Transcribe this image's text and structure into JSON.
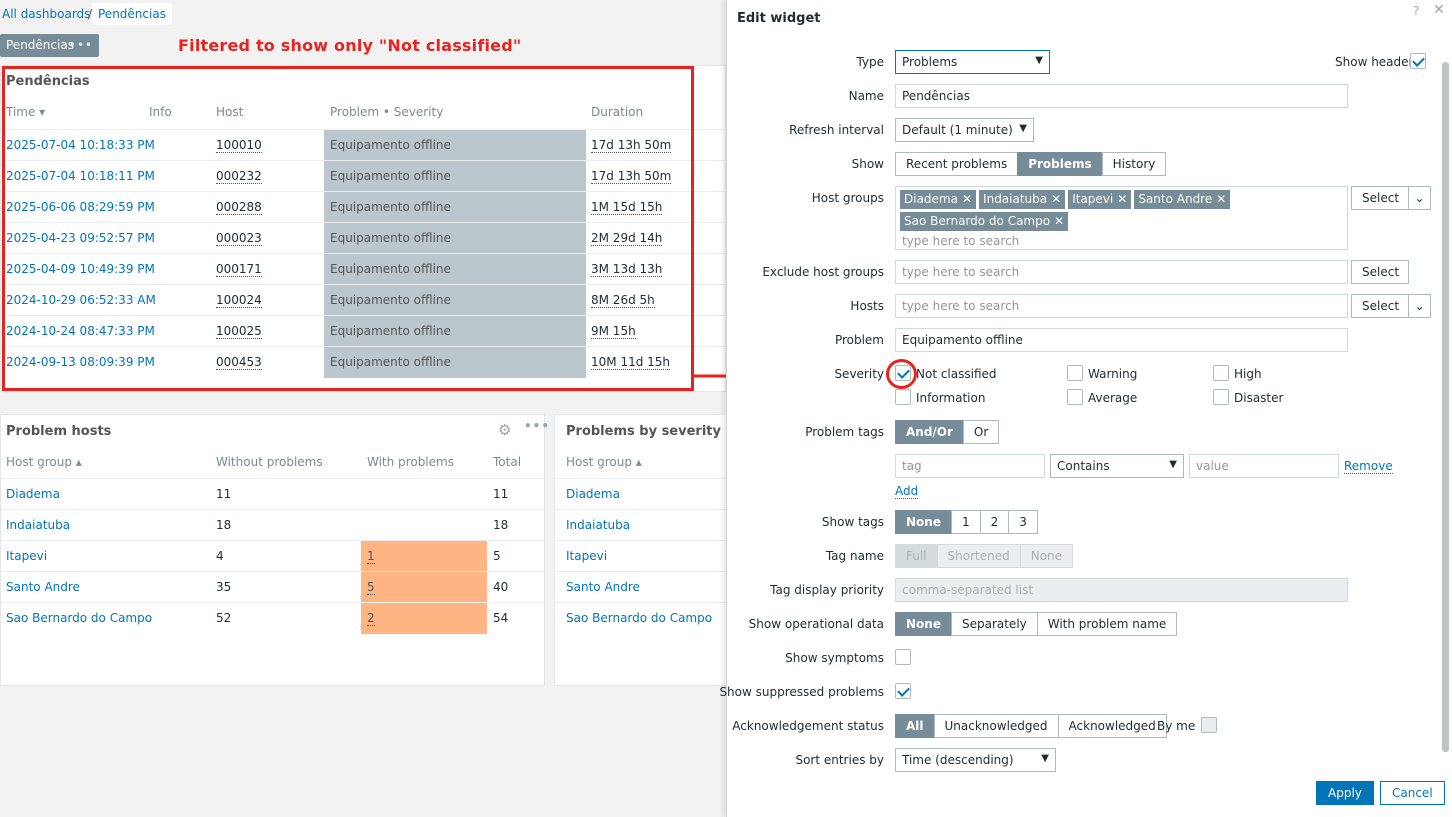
{
  "breadcrumb": {
    "root": "All dashboards",
    "sep": "/",
    "current": "Pendências"
  },
  "page_tab": {
    "label": "Pendências",
    "menu": "•••"
  },
  "annotation": {
    "text": "Filtered to show only \"Not classified\""
  },
  "problems_widget": {
    "title": "Pendências",
    "columns": {
      "time": "Time ▾",
      "info": "Info",
      "host": "Host",
      "problem": "Problem • Severity",
      "duration": "Duration"
    },
    "rows": [
      {
        "time": "2025-07-04 10:18:33 PM",
        "host": "100010",
        "problem": "Equipamento offline",
        "duration": "17d 13h 50m"
      },
      {
        "time": "2025-07-04 10:18:11 PM",
        "host": "000232",
        "problem": "Equipamento offline",
        "duration": "17d 13h 50m"
      },
      {
        "time": "2025-06-06 08:29:59 PM",
        "host": "000288",
        "problem": "Equipamento offline",
        "duration": "1M 15d 15h"
      },
      {
        "time": "2025-04-23 09:52:57 PM",
        "host": "000023",
        "problem": "Equipamento offline",
        "duration": "2M 29d 14h"
      },
      {
        "time": "2025-04-09 10:49:39 PM",
        "host": "000171",
        "problem": "Equipamento offline",
        "duration": "3M 13d 13h"
      },
      {
        "time": "2024-10-29 06:52:33 AM",
        "host": "100024",
        "problem": "Equipamento offline",
        "duration": "8M 26d 5h"
      },
      {
        "time": "2024-10-24 08:47:33 PM",
        "host": "100025",
        "problem": "Equipamento offline",
        "duration": "9M 15h"
      },
      {
        "time": "2024-09-13 08:09:39 PM",
        "host": "000453",
        "problem": "Equipamento offline",
        "duration": "10M 11d 15h"
      }
    ]
  },
  "problem_hosts": {
    "title": "Problem hosts",
    "columns": {
      "group": "Host group ▴",
      "without": "Without problems",
      "with": "With problems",
      "total": "Total"
    },
    "rows": [
      {
        "group": "Diadema",
        "without": "11",
        "with": "",
        "total": "11"
      },
      {
        "group": "Indaiatuba",
        "without": "18",
        "with": "",
        "total": "18"
      },
      {
        "group": "Itapevi",
        "without": "4",
        "with": "1",
        "total": "5"
      },
      {
        "group": "Santo Andre",
        "without": "35",
        "with": "5",
        "total": "40"
      },
      {
        "group": "Sao Bernardo do Campo",
        "without": "52",
        "with": "2",
        "total": "54"
      }
    ],
    "widget_menu": "•••"
  },
  "problems_by_severity": {
    "title": "Problems by severity",
    "columns": {
      "group": "Host group ▴"
    },
    "rows": [
      "Diadema",
      "Indaiatuba",
      "Itapevi",
      "Santo Andre",
      "Sao Bernardo do Campo"
    ]
  },
  "dialog": {
    "title": "Edit widget",
    "help": "?",
    "close": "✕",
    "type": {
      "label": "Type",
      "value": "Problems"
    },
    "show_header": {
      "label": "Show header",
      "checked": true
    },
    "name": {
      "label": "Name",
      "value": "Pendências"
    },
    "refresh": {
      "label": "Refresh interval",
      "value": "Default (1 minute)"
    },
    "show": {
      "label": "Show",
      "options": [
        "Recent problems",
        "Problems",
        "History"
      ],
      "selected": "Problems"
    },
    "host_groups": {
      "label": "Host groups",
      "tags": [
        "Diadema",
        "Indaiatuba",
        "Itapevi",
        "Santo Andre",
        "Sao Bernardo do Campo"
      ],
      "placeholder": "type here to search",
      "select": "Select"
    },
    "exclude_host_groups": {
      "label": "Exclude host groups",
      "placeholder": "type here to search",
      "select": "Select"
    },
    "hosts": {
      "label": "Hosts",
      "placeholder": "type here to search",
      "select": "Select"
    },
    "problem": {
      "label": "Problem",
      "value": "Equipamento offline"
    },
    "severity": {
      "label": "Severity",
      "options": [
        {
          "name": "Not classified",
          "checked": true
        },
        {
          "name": "Information",
          "checked": false
        },
        {
          "name": "Warning",
          "checked": false
        },
        {
          "name": "Average",
          "checked": false
        },
        {
          "name": "High",
          "checked": false
        },
        {
          "name": "Disaster",
          "checked": false
        }
      ]
    },
    "problem_tags": {
      "label": "Problem tags",
      "options": [
        "And/Or",
        "Or"
      ],
      "selected": "And/Or",
      "tag_placeholder": "tag",
      "operator": "Contains",
      "value_placeholder": "value",
      "remove": "Remove",
      "add": "Add"
    },
    "show_tags": {
      "label": "Show tags",
      "options": [
        "None",
        "1",
        "2",
        "3"
      ],
      "selected": "None"
    },
    "tag_name": {
      "label": "Tag name",
      "options": [
        "Full",
        "Shortened",
        "None"
      ],
      "selected": "Full"
    },
    "tag_priority": {
      "label": "Tag display priority",
      "placeholder": "comma-separated list"
    },
    "operational_data": {
      "label": "Show operational data",
      "options": [
        "None",
        "Separately",
        "With problem name"
      ],
      "selected": "None"
    },
    "show_symptoms": {
      "label": "Show symptoms",
      "checked": false
    },
    "show_suppressed": {
      "label": "Show suppressed problems",
      "checked": true
    },
    "ack_status": {
      "label": "Acknowledgement status",
      "options": [
        "All",
        "Unacknowledged",
        "Acknowledged"
      ],
      "selected": "All",
      "by_me": "By me"
    },
    "sort": {
      "label": "Sort entries by",
      "value": "Time (descending)"
    },
    "apply": "Apply",
    "cancel": "Cancel"
  },
  "colors": {
    "accent": "#0275b8",
    "annotation": "#e8231f",
    "severity_bg": "#bcc7cd",
    "problem_bg": "#ffb484"
  }
}
